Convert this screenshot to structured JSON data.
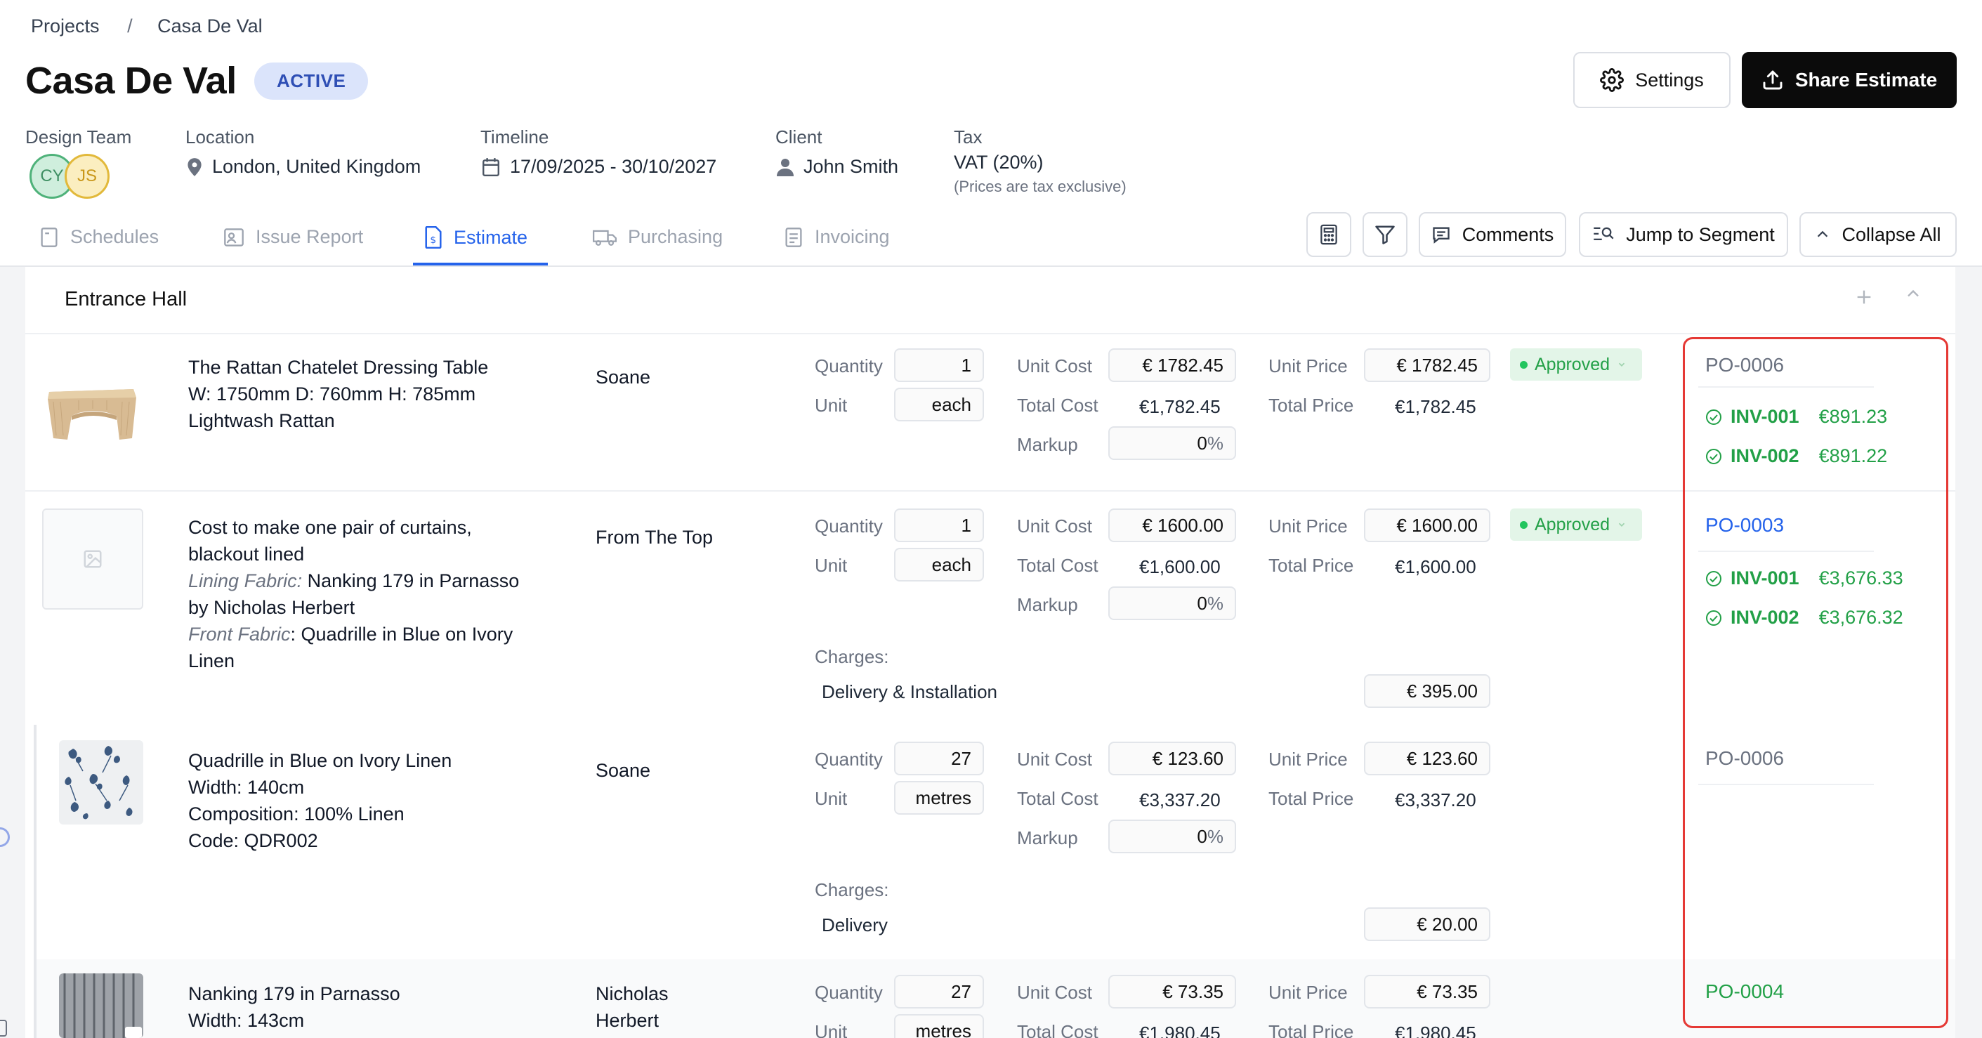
{
  "breadcrumb": {
    "root": "Projects",
    "separator": "/",
    "current": "Casa De Val"
  },
  "project": {
    "title": "Casa De Val",
    "status": "ACTIVE"
  },
  "header_buttons": {
    "settings": "Settings",
    "share": "Share Estimate"
  },
  "meta": {
    "design_team_label": "Design Team",
    "avatars": [
      "CY",
      "JS"
    ],
    "location_label": "Location",
    "location_value": "London, United Kingdom",
    "timeline_label": "Timeline",
    "timeline_value": "17/09/2025 - 30/10/2027",
    "client_label": "Client",
    "client_value": "John Smith",
    "tax_label": "Tax",
    "tax_value": "VAT (20%)",
    "tax_note": "(Prices are tax exclusive)"
  },
  "tabs": [
    "Schedules",
    "Issue Report",
    "Estimate",
    "Purchasing",
    "Invoicing"
  ],
  "active_tab": "Estimate",
  "toolbar": {
    "comments": "Comments",
    "jump": "Jump to Segment",
    "collapse": "Collapse All"
  },
  "segment": {
    "title": "Entrance Hall"
  },
  "field_labels": {
    "quantity": "Quantity",
    "unit": "Unit",
    "unit_cost": "Unit Cost",
    "total_cost": "Total Cost",
    "markup": "Markup",
    "unit_price": "Unit Price",
    "total_price": "Total Price",
    "charges": "Charges:"
  },
  "items": [
    {
      "desc": [
        "The Rattan Chatelet Dressing Table",
        "W: 1750mm D: 760mm H: 785mm",
        "Lightwash Rattan"
      ],
      "vendor": "Soane",
      "quantity": "1",
      "unit": "each",
      "unit_cost": "€ 1782.45",
      "total_cost": "€1,782.45",
      "markup": "0",
      "unit_price": "€ 1782.45",
      "total_price": "€1,782.45",
      "status": "Approved",
      "po": "PO-0006",
      "invoices": [
        {
          "id": "INV-001",
          "amount": "€891.23"
        },
        {
          "id": "INV-002",
          "amount": "€891.22"
        }
      ]
    },
    {
      "desc_lines": [
        "Cost to make one pair of curtains,",
        "blackout lined"
      ],
      "lining_label": "Lining Fabric:",
      "lining_value": " Nanking 179 in Parnasso",
      "lining_value2": "by Nicholas Herbert",
      "front_label": "Front Fabric",
      "front_value": ": Quadrille in Blue on Ivory",
      "front_value2": "Linen",
      "vendor": "From The Top",
      "quantity": "1",
      "unit": "each",
      "unit_cost": "€ 1600.00",
      "total_cost": "€1,600.00",
      "markup": "0",
      "unit_price": "€ 1600.00",
      "total_price": "€1,600.00",
      "status": "Approved",
      "charge_name": "Delivery & Installation",
      "charge_value": "€ 395.00",
      "po": "PO-0003",
      "invoices": [
        {
          "id": "INV-001",
          "amount": "€3,676.33"
        },
        {
          "id": "INV-002",
          "amount": "€3,676.32"
        }
      ]
    },
    {
      "desc": [
        "Quadrille in Blue on Ivory Linen",
        "Width: 140cm",
        "Composition: 100% Linen",
        "Code: QDR002"
      ],
      "vendor": "Soane",
      "quantity": "27",
      "unit": "metres",
      "unit_cost": "€ 123.60",
      "total_cost": "€3,337.20",
      "markup": "0",
      "unit_price": "€ 123.60",
      "total_price": "€3,337.20",
      "charge_name": "Delivery",
      "charge_value": "€ 20.00",
      "po": "PO-0006"
    },
    {
      "desc": [
        "Nanking 179 in Parnasso",
        "Width: 143cm"
      ],
      "vendor": [
        "Nicholas",
        "Herbert"
      ],
      "quantity": "27",
      "unit": "metres",
      "unit_cost": "€ 73.35",
      "total_cost": "€1,980.45",
      "unit_price": "€ 73.35",
      "total_price": "€1,980.45",
      "po": "PO-0004"
    }
  ],
  "percent_sign": "%"
}
